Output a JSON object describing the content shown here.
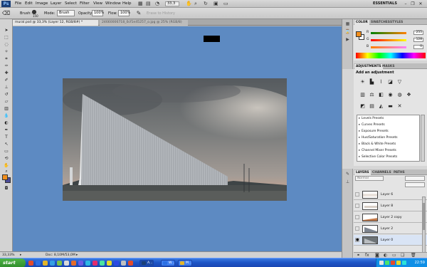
{
  "app": {
    "logo": "Ps",
    "zoom": "33,3",
    "workspace": "ESSENTIALS"
  },
  "menu": [
    "File",
    "Edit",
    "Image",
    "Layer",
    "Select",
    "Filter",
    "View",
    "Window",
    "Help"
  ],
  "options": {
    "brush_label": "Brush:",
    "brush_size": "150",
    "mode_label": "Mode:",
    "mode_value": "Brush",
    "opacity_label": "Opacity:",
    "opacity_value": "100%",
    "flow_label": "Flow:",
    "flow_value": "100%",
    "erase_history": "Erase to History"
  },
  "tabs": [
    {
      "label": "mural.psd @ 33,3% (Layer 12, RGB/8#) *",
      "active": true
    },
    {
      "label": "24660006718_0cf1e45257_o.jpg @ 25% (RGB/8)",
      "active": false
    }
  ],
  "status": {
    "zoom": "33,33%",
    "doc": "Doc: 8,10M/53,0M"
  },
  "color_panel": {
    "tabs": [
      "COLOR",
      "SWATCHES",
      "STYLES"
    ],
    "fg": "#f28e1c",
    "r_label": "R",
    "r_value": "255",
    "g_label": "G",
    "g_value": "128",
    "b_label": "B",
    "b_value": "0"
  },
  "adjustments": {
    "tabs": [
      "ADJUSTMENTS",
      "MASKS"
    ],
    "title": "Add an adjustment",
    "presets": [
      "Levels Presets",
      "Curves Presets",
      "Exposure Presets",
      "Hue/Saturation Presets",
      "Black & White Presets",
      "Channel Mixer Presets",
      "Selective Color Presets"
    ]
  },
  "layers_panel": {
    "tabs": [
      "LAYERS",
      "CHANNELS",
      "PATHS"
    ],
    "blend_mode": "Normal",
    "layers": [
      {
        "name": "Layer 6",
        "visible": false,
        "thumb": "sky"
      },
      {
        "name": "Layer 8",
        "visible": false,
        "thumb": "sky"
      },
      {
        "name": "Layer 2 copy",
        "visible": false,
        "thumb": "warm"
      },
      {
        "name": "Layer 2",
        "visible": false,
        "thumb": "mural"
      },
      {
        "name": "Layer 0",
        "visible": true,
        "thumb": "photo"
      }
    ]
  },
  "taskbar": {
    "start": "start",
    "tasks": [
      "A...",
      "W...",
      "M..."
    ],
    "clock": "22:59"
  },
  "colors": {
    "canvas_bg": "#5d8ac2",
    "foreground": "#f28e1c",
    "background": "#4c4c9a",
    "taskbar": "#245edb"
  }
}
